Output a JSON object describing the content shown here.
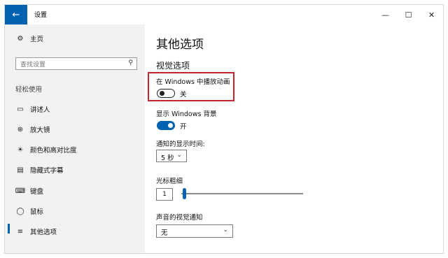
{
  "window": {
    "title": "设置",
    "back_icon": "←",
    "min_icon": "—",
    "max_icon": "☐",
    "close_icon": "✕"
  },
  "sidebar": {
    "home": {
      "label": "主页",
      "icon": "⚙"
    },
    "search": {
      "placeholder": "查找设置",
      "icon": "⚲"
    },
    "section_title": "轻松使用",
    "items": [
      {
        "label": "讲述人",
        "icon": "▭"
      },
      {
        "label": "放大镜",
        "icon": "⊕"
      },
      {
        "label": "颜色和高对比度",
        "icon": "☀"
      },
      {
        "label": "隐藏式字幕",
        "icon": "▤"
      },
      {
        "label": "键盘",
        "icon": "⌨"
      },
      {
        "label": "鼠标",
        "icon": "◯"
      },
      {
        "label": "其他选项",
        "icon": "≡",
        "active": true
      }
    ]
  },
  "main": {
    "title": "其他选项",
    "subtitle": "视觉选项",
    "animations": {
      "label": "在 Windows 中播放动画",
      "state": "关"
    },
    "background": {
      "label": "显示 Windows 背景",
      "state": "开"
    },
    "notify_time": {
      "label": "通知的显示时间:",
      "value": "5 秒"
    },
    "cursor": {
      "label": "光标粗细",
      "value": "1",
      "level": 0
    },
    "sound_notify": {
      "label": "声音的视觉通知",
      "value": "无"
    }
  },
  "colors": {
    "accent": "#0063b1",
    "highlight_box": "#c0282d",
    "sidebar_bg": "#f2f2f2"
  }
}
